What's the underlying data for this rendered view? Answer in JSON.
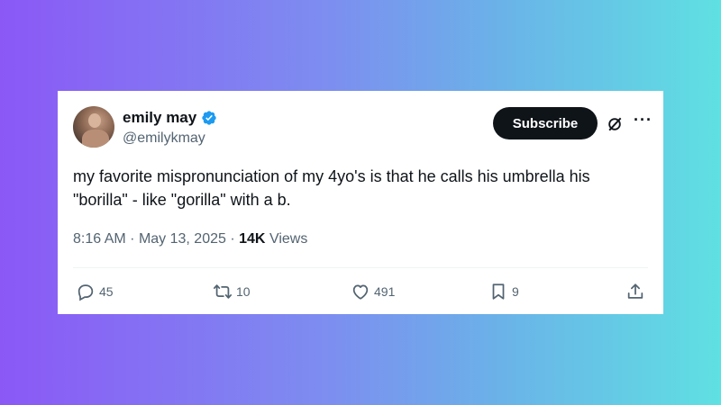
{
  "tweet": {
    "author_name": "emily may",
    "author_handle": "@emilykmay",
    "verified": true,
    "subscribe_label": "Subscribe",
    "more_label": "···",
    "text": "my favorite mispronunciation of my 4yo's is that he calls his umbrella his\n\"borilla\" - like \"gorilla\" with a b.",
    "time": "8:16 AM",
    "date": "May 13, 2025",
    "separator": "·",
    "views_count": "14K",
    "views_label": "Views",
    "replies": "45",
    "reposts": "10",
    "likes": "491",
    "bookmarks": "9"
  },
  "colors": {
    "gradient_start": "#8b58f6",
    "gradient_end": "#5fe0e2",
    "verified_blue": "#1d9bf0",
    "text_primary": "#0f1419",
    "text_secondary": "#536471"
  }
}
